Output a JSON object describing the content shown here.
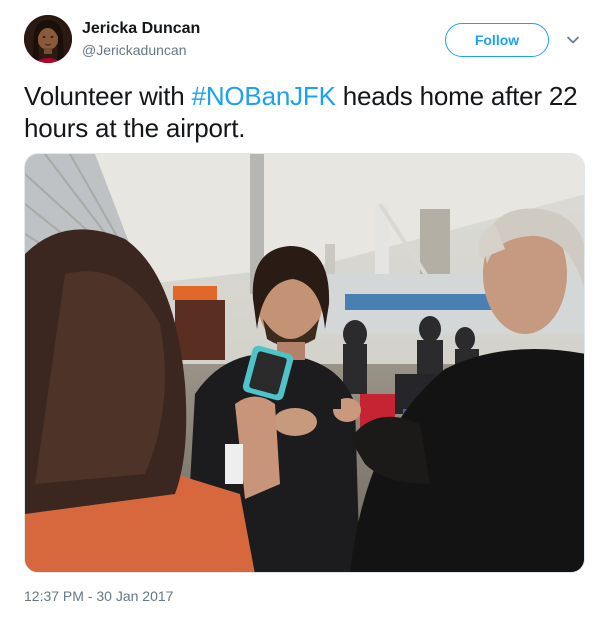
{
  "user": {
    "display_name": "Jericka Duncan",
    "handle": "@Jerickaduncan"
  },
  "follow_button": {
    "label": "Follow"
  },
  "tweet": {
    "text_before": "Volunteer with ",
    "hashtag": "#NOBanJFK",
    "text_after": " heads home after 22 hours at the airport.",
    "timestamp": "12:37 PM - 30 Jan 2017"
  },
  "colors": {
    "accent": "#1da1f2",
    "text": "#14171a",
    "muted": "#657786"
  },
  "icons": {
    "caret": "chevron-down-icon"
  }
}
